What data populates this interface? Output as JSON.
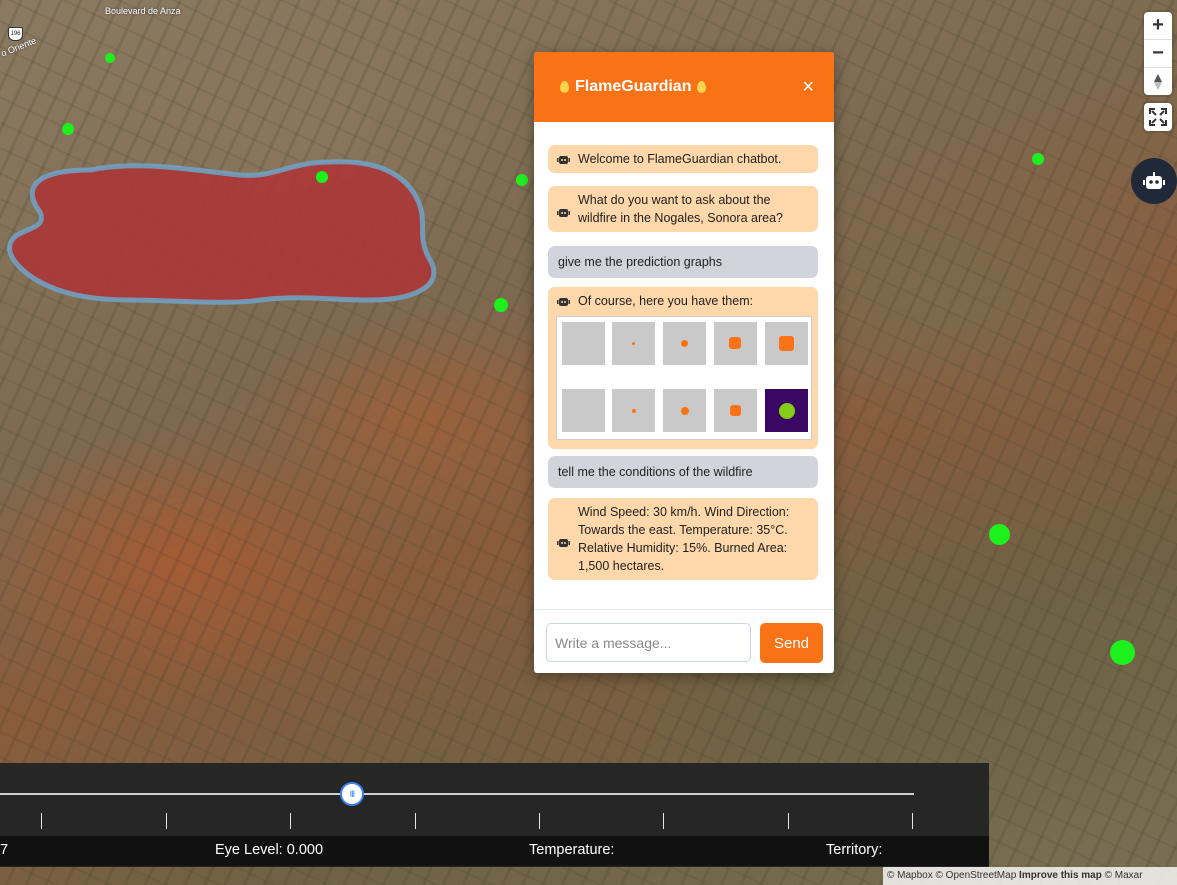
{
  "map": {
    "road_label_top": "Boulevard de Anza",
    "road_label_left": "o Oriente",
    "shield_number": "196"
  },
  "nav_controls": {
    "zoom_in": "+",
    "zoom_out": "−"
  },
  "chat": {
    "title": "FlameGuardian",
    "close_icon": "×",
    "messages": [
      {
        "role": "bot",
        "text": "Welcome to FlameGuardian chatbot."
      },
      {
        "role": "bot",
        "text": "What do you want to ask about the wildfire in the Nogales, Sonora area?"
      },
      {
        "role": "user",
        "text": "give me the prediction graphs"
      },
      {
        "role": "bot",
        "text": "Of course, here you have them:"
      },
      {
        "role": "user",
        "text": "tell me the conditions of the wildfire"
      },
      {
        "role": "bot",
        "text": "Wind Speed: 30 km/h. Wind Direction: Towards the east. Temperature: 35°C. Relative Humidity: 15%. Burned Area: 1,500 hectares."
      }
    ],
    "input_placeholder": "Write a message...",
    "send_label": "Send"
  },
  "timeline": {
    "slider_fraction": 0.385,
    "status_left": "7",
    "eye_level": "Eye Level: 0.000",
    "temperature": "Temperature:",
    "territory": "Territory:"
  },
  "attribution": {
    "mapbox": "© Mapbox",
    "osm": "© OpenStreetMap",
    "improve": "Improve this map",
    "maxar": "© Maxar"
  },
  "colors": {
    "accent": "#f97316",
    "fire_area": "#b03a3a",
    "hotspot": "#1ef01e"
  }
}
